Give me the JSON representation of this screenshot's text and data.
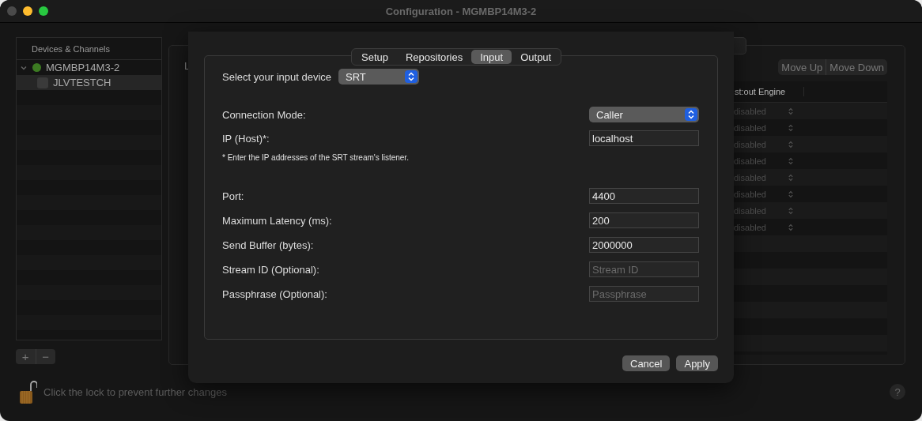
{
  "window": {
    "title": "Configuration - MGMBP14M3-2"
  },
  "sidebar": {
    "header": "Devices & Channels",
    "items": [
      {
        "label": "MGMBP14M3-2",
        "expanded": true,
        "selected": false,
        "color": "#3c7a22",
        "children": [
          {
            "label": "JLVTESTCH",
            "checked": false,
            "selected": true
          }
        ]
      }
    ]
  },
  "sidebar_buttons": [
    "+",
    "−"
  ],
  "lock_message": "Click the lock to prevent further changes",
  "main": {
    "label_fragment": "L",
    "move_buttons": [
      {
        "label": "Move Up",
        "disabled": true
      },
      {
        "label": "Move Down",
        "disabled": true
      }
    ],
    "table": {
      "columns": [
        "st:out Engine"
      ],
      "rows": [
        {
          "cell": "disabled"
        },
        {
          "cell": "disabled"
        },
        {
          "cell": "disabled"
        },
        {
          "cell": "disabled"
        },
        {
          "cell": "disabled"
        },
        {
          "cell": "disabled"
        },
        {
          "cell": "disabled"
        },
        {
          "cell": "disabled"
        }
      ]
    }
  },
  "help": "?",
  "sheet": {
    "tabs": [
      {
        "label": "Setup",
        "selected": false
      },
      {
        "label": "Repositories",
        "selected": false
      },
      {
        "label": "Input",
        "selected": true
      },
      {
        "label": "Output",
        "selected": false
      }
    ],
    "device": {
      "label": "Select your input device",
      "value": "SRT"
    },
    "fields": [
      {
        "kind": "popup",
        "label": "Connection Mode:",
        "value": "Caller"
      },
      {
        "kind": "text",
        "label": "IP (Host)*:",
        "value": "localhost"
      },
      {
        "kind": "note",
        "text": "* Enter the IP addresses of the SRT stream's listener."
      },
      {
        "kind": "text",
        "label": "Port:",
        "value": "4400"
      },
      {
        "kind": "text",
        "label": "Maximum Latency (ms):",
        "value": "200"
      },
      {
        "kind": "text",
        "label": "Send Buffer (bytes):",
        "value": "2000000"
      },
      {
        "kind": "text",
        "label": "Stream ID (Optional):",
        "placeholder": "Stream ID"
      },
      {
        "kind": "text",
        "label": "Passphrase (Optional):",
        "placeholder": "Passphrase"
      }
    ],
    "buttons": [
      "Cancel",
      "Apply"
    ]
  }
}
